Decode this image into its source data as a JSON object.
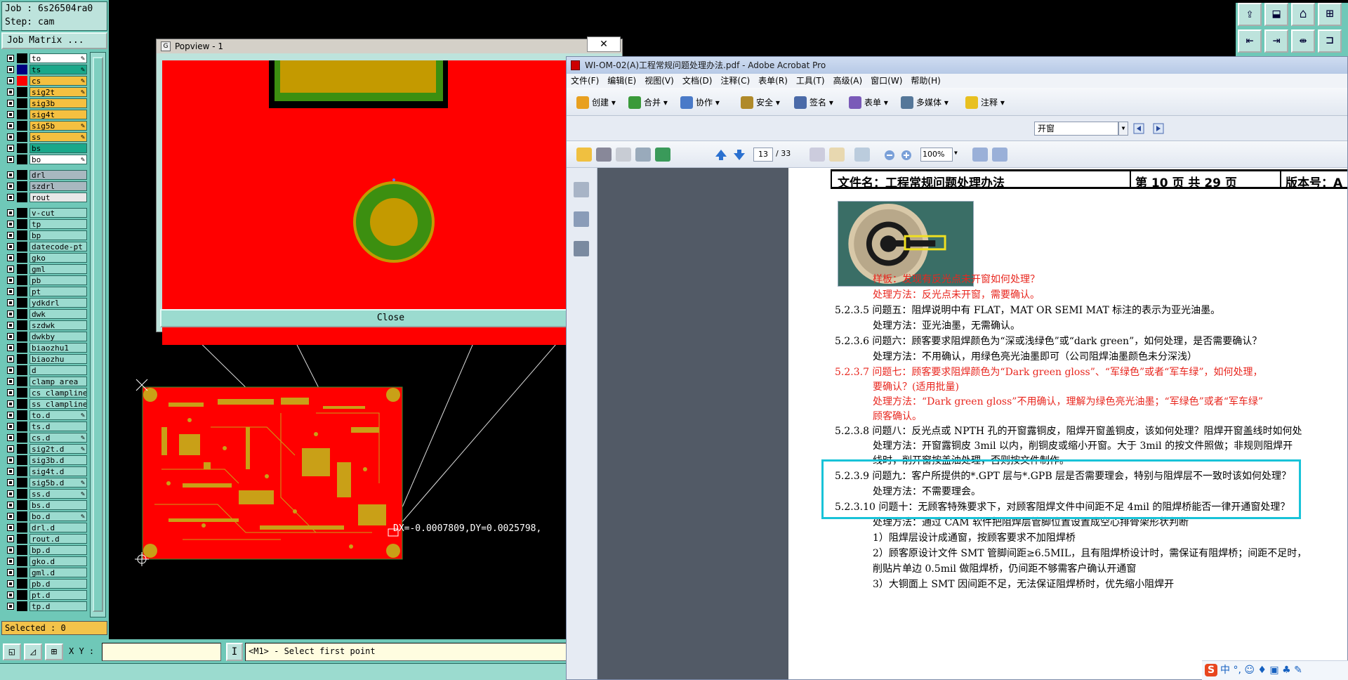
{
  "genesis": {
    "job_line": "Job : 6s26504ra0",
    "step_line": "Step: cam",
    "job_matrix_button": "Job Matrix ...",
    "selected": "Selected : 0",
    "xy_label": "X Y :",
    "prompt": "<M1> - Select first point",
    "measure_text": "DX=-0.0007809,DY=0.0025798,",
    "layers": [
      {
        "name": "to",
        "color": "#ffffff",
        "swatch": "#000000",
        "editable": true
      },
      {
        "name": "ts",
        "color": "#1aa88a",
        "swatch": "#000080",
        "editable": true
      },
      {
        "name": "cs",
        "color": "#f5c040",
        "swatch": "#ff0000",
        "editable": true
      },
      {
        "name": "sig2t",
        "color": "#f5c040",
        "swatch": "#000000",
        "editable": true
      },
      {
        "name": "sig3b",
        "color": "#f5c040",
        "swatch": "#000000",
        "editable": false
      },
      {
        "name": "sig4t",
        "color": "#f5c040",
        "swatch": "#000000",
        "editable": false
      },
      {
        "name": "sig5b",
        "color": "#f5c040",
        "swatch": "#000000",
        "editable": true
      },
      {
        "name": "ss",
        "color": "#f5c040",
        "swatch": "#000000",
        "editable": true
      },
      {
        "name": "bs",
        "color": "#1aa88a",
        "swatch": "#000000",
        "editable": false
      },
      {
        "name": "bo",
        "color": "#ffffff",
        "swatch": "#000000",
        "editable": true
      },
      {
        "name": "drl",
        "color": "#a8b8c0",
        "swatch": "#000000",
        "editable": false
      },
      {
        "name": "szdrl",
        "color": "#a8b8c0",
        "swatch": "#000000",
        "editable": false
      },
      {
        "name": "rout",
        "color": "#e8e8e8",
        "swatch": "#000000",
        "editable": false
      },
      {
        "name": "v-cut",
        "color": "#9bdbcf",
        "swatch": "#000000",
        "editable": false
      },
      {
        "name": "tp",
        "color": "#9bdbcf",
        "swatch": "#000000",
        "editable": false
      },
      {
        "name": "bp",
        "color": "#9bdbcf",
        "swatch": "#000000",
        "editable": false
      },
      {
        "name": "datecode-pt",
        "color": "#9bdbcf",
        "swatch": "#000000",
        "editable": false
      },
      {
        "name": "gko",
        "color": "#9bdbcf",
        "swatch": "#000000",
        "editable": false
      },
      {
        "name": "gml",
        "color": "#9bdbcf",
        "swatch": "#000000",
        "editable": false
      },
      {
        "name": "pb",
        "color": "#9bdbcf",
        "swatch": "#000000",
        "editable": false
      },
      {
        "name": "pt",
        "color": "#9bdbcf",
        "swatch": "#000000",
        "editable": false
      },
      {
        "name": "ydkdrl",
        "color": "#9bdbcf",
        "swatch": "#000000",
        "editable": false
      },
      {
        "name": "dwk",
        "color": "#9bdbcf",
        "swatch": "#000000",
        "editable": false
      },
      {
        "name": "szdwk",
        "color": "#9bdbcf",
        "swatch": "#000000",
        "editable": false
      },
      {
        "name": "dwkby",
        "color": "#9bdbcf",
        "swatch": "#000000",
        "editable": false
      },
      {
        "name": "biaozhu1",
        "color": "#9bdbcf",
        "swatch": "#000000",
        "editable": false
      },
      {
        "name": "biaozhu",
        "color": "#9bdbcf",
        "swatch": "#000000",
        "editable": false
      },
      {
        "name": "d",
        "color": "#9bdbcf",
        "swatch": "#000000",
        "editable": false
      },
      {
        "name": "clamp_area",
        "color": "#9bdbcf",
        "swatch": "#000000",
        "editable": false
      },
      {
        "name": "cs_clampline",
        "color": "#9bdbcf",
        "swatch": "#000000",
        "editable": false
      },
      {
        "name": "ss_clampline",
        "color": "#9bdbcf",
        "swatch": "#000000",
        "editable": false
      },
      {
        "name": "to.d",
        "color": "#9bdbcf",
        "swatch": "#000000",
        "editable": true
      },
      {
        "name": "ts.d",
        "color": "#9bdbcf",
        "swatch": "#000000",
        "editable": false
      },
      {
        "name": "cs.d",
        "color": "#9bdbcf",
        "swatch": "#000000",
        "editable": true
      },
      {
        "name": "sig2t.d",
        "color": "#9bdbcf",
        "swatch": "#000000",
        "editable": true
      },
      {
        "name": "sig3b.d",
        "color": "#9bdbcf",
        "swatch": "#000000",
        "editable": false
      },
      {
        "name": "sig4t.d",
        "color": "#9bdbcf",
        "swatch": "#000000",
        "editable": false
      },
      {
        "name": "sig5b.d",
        "color": "#9bdbcf",
        "swatch": "#000000",
        "editable": true
      },
      {
        "name": "ss.d",
        "color": "#9bdbcf",
        "swatch": "#000000",
        "editable": true
      },
      {
        "name": "bs.d",
        "color": "#9bdbcf",
        "swatch": "#000000",
        "editable": false
      },
      {
        "name": "bo.d",
        "color": "#9bdbcf",
        "swatch": "#000000",
        "editable": true
      },
      {
        "name": "drl.d",
        "color": "#9bdbcf",
        "swatch": "#000000",
        "editable": false
      },
      {
        "name": "rout.d",
        "color": "#9bdbcf",
        "swatch": "#000000",
        "editable": false
      },
      {
        "name": "bp.d",
        "color": "#9bdbcf",
        "swatch": "#000000",
        "editable": false
      },
      {
        "name": "gko.d",
        "color": "#9bdbcf",
        "swatch": "#000000",
        "editable": false
      },
      {
        "name": "gml.d",
        "color": "#9bdbcf",
        "swatch": "#000000",
        "editable": false
      },
      {
        "name": "pb.d",
        "color": "#9bdbcf",
        "swatch": "#000000",
        "editable": false
      },
      {
        "name": "pt.d",
        "color": "#9bdbcf",
        "swatch": "#000000",
        "editable": false
      },
      {
        "name": "tp.d",
        "color": "#9bdbcf",
        "swatch": "#000000",
        "editable": false
      }
    ]
  },
  "popview": {
    "title": "Popview - 1",
    "close_x": "✕",
    "close_button": "Close"
  },
  "acrobat": {
    "title": "WI-OM-02(A)工程常规问题处理办法.pdf - Adobe Acrobat Pro",
    "menu": [
      "文件(F)",
      "编辑(E)",
      "视图(V)",
      "文档(D)",
      "注释(C)",
      "表单(R)",
      "工具(T)",
      "高级(A)",
      "窗口(W)",
      "帮助(H)"
    ],
    "tools": [
      "创建",
      "合并",
      "协作",
      "安全",
      "签名",
      "表单",
      "多媒体",
      "注释"
    ],
    "find_value": "开窗",
    "page_current": "13",
    "page_total": "/ 33",
    "zoom": "100%",
    "header": {
      "file_name": "文件名：工程常规问题处理办法",
      "page_info": "第 10 页 共 29 页",
      "version": "版本号：A"
    },
    "lines": [
      {
        "text": "样板：发现有反光点未开窗如何处理？",
        "red": true
      },
      {
        "text": "处理方法：反光点未开窗，需要确认。",
        "red": true
      },
      {
        "text": "5.2.3.5  问题五：阻焊说明中有 FLAT，MAT OR SEMI MAT 标注的表示为亚光油墨。",
        "red": false
      },
      {
        "text": "处理方法：亚光油墨，无需确认。",
        "red": false
      },
      {
        "text": "5.2.3.6  问题六：顾客要求阻焊颜色为“深或浅绿色”或“dark green”，如何处理，是否需要确认？",
        "red": false
      },
      {
        "text": "处理方法：不用确认，用绿色亮光油墨即可（公司阻焊油墨颜色未分深浅）",
        "red": false
      },
      {
        "text": "5.2.3.7  问题七：顾客要求阻焊颜色为“Dark green gloss”、“军绿色”或者“军车绿”，如何处理，",
        "red": true
      },
      {
        "text": "要确认？(适用批量)",
        "red": true
      },
      {
        "text": "处理方法：“Dark green gloss”不用确认，理解为绿色亮光油墨；“军绿色”或者“军车绿”",
        "red": true
      },
      {
        "text": "顾客确认。",
        "red": true
      },
      {
        "text": "5.2.3.8  问题八：反光点或 NPTH 孔的开窗露铜皮，阻焊开窗盖铜皮，该如何处理？阻焊开窗盖线时如何处",
        "red": false
      },
      {
        "text": "处理方法：开窗露铜皮 3mil 以内，削铜皮或缩小开窗。大于 3mil 的按文件照做；非规则阻焊开",
        "red": false
      },
      {
        "text": "线时，削开窗按盖油处理，否则按文件制作。",
        "red": false
      },
      {
        "text": "5.2.3.9  问题九：客户所提供的*.GPT 层与*.GPB 层是否需要理会，特别与阻焊层不一致时该如何处理？",
        "red": false
      },
      {
        "text": "处理方法：不需要理会。",
        "red": false
      },
      {
        "text": "5.2.3.10  问题十：无顾客特殊要求下，对顾客阻焊文件中间距不足 4mil 的阻焊桥能否一律开通窗处理？",
        "red": false
      },
      {
        "text": "处理方法：通过 CAM 软件把阻焊层管脚位置设置成空心排骨架形状判断",
        "red": false
      },
      {
        "text": "1）阻焊层设计成通窗，按顾客要求不加阻焊桥",
        "red": false
      },
      {
        "text": "2）顾客原设计文件 SMT 管脚间距≥6.5MIL，且有阻焊桥设计时，需保证有阻焊桥；间距不足时，",
        "red": false
      },
      {
        "text": "削贴片单边 0.5mil 做阻焊桥，仍间距不够需客户确认开通窗",
        "red": false
      },
      {
        "text": "3）大铜面上 SMT 因间距不足，无法保证阻焊桥时，优先缩小阻焊开",
        "red": false
      }
    ],
    "ime": "中 °, ☺ ♦ ▣ ♣ ✎"
  },
  "toolbar_icons": [
    "window-icon",
    "window-icon",
    "home-icon",
    "grid-icon",
    "left-icon",
    "right-icon",
    "split-icon",
    "bracket-icon"
  ]
}
